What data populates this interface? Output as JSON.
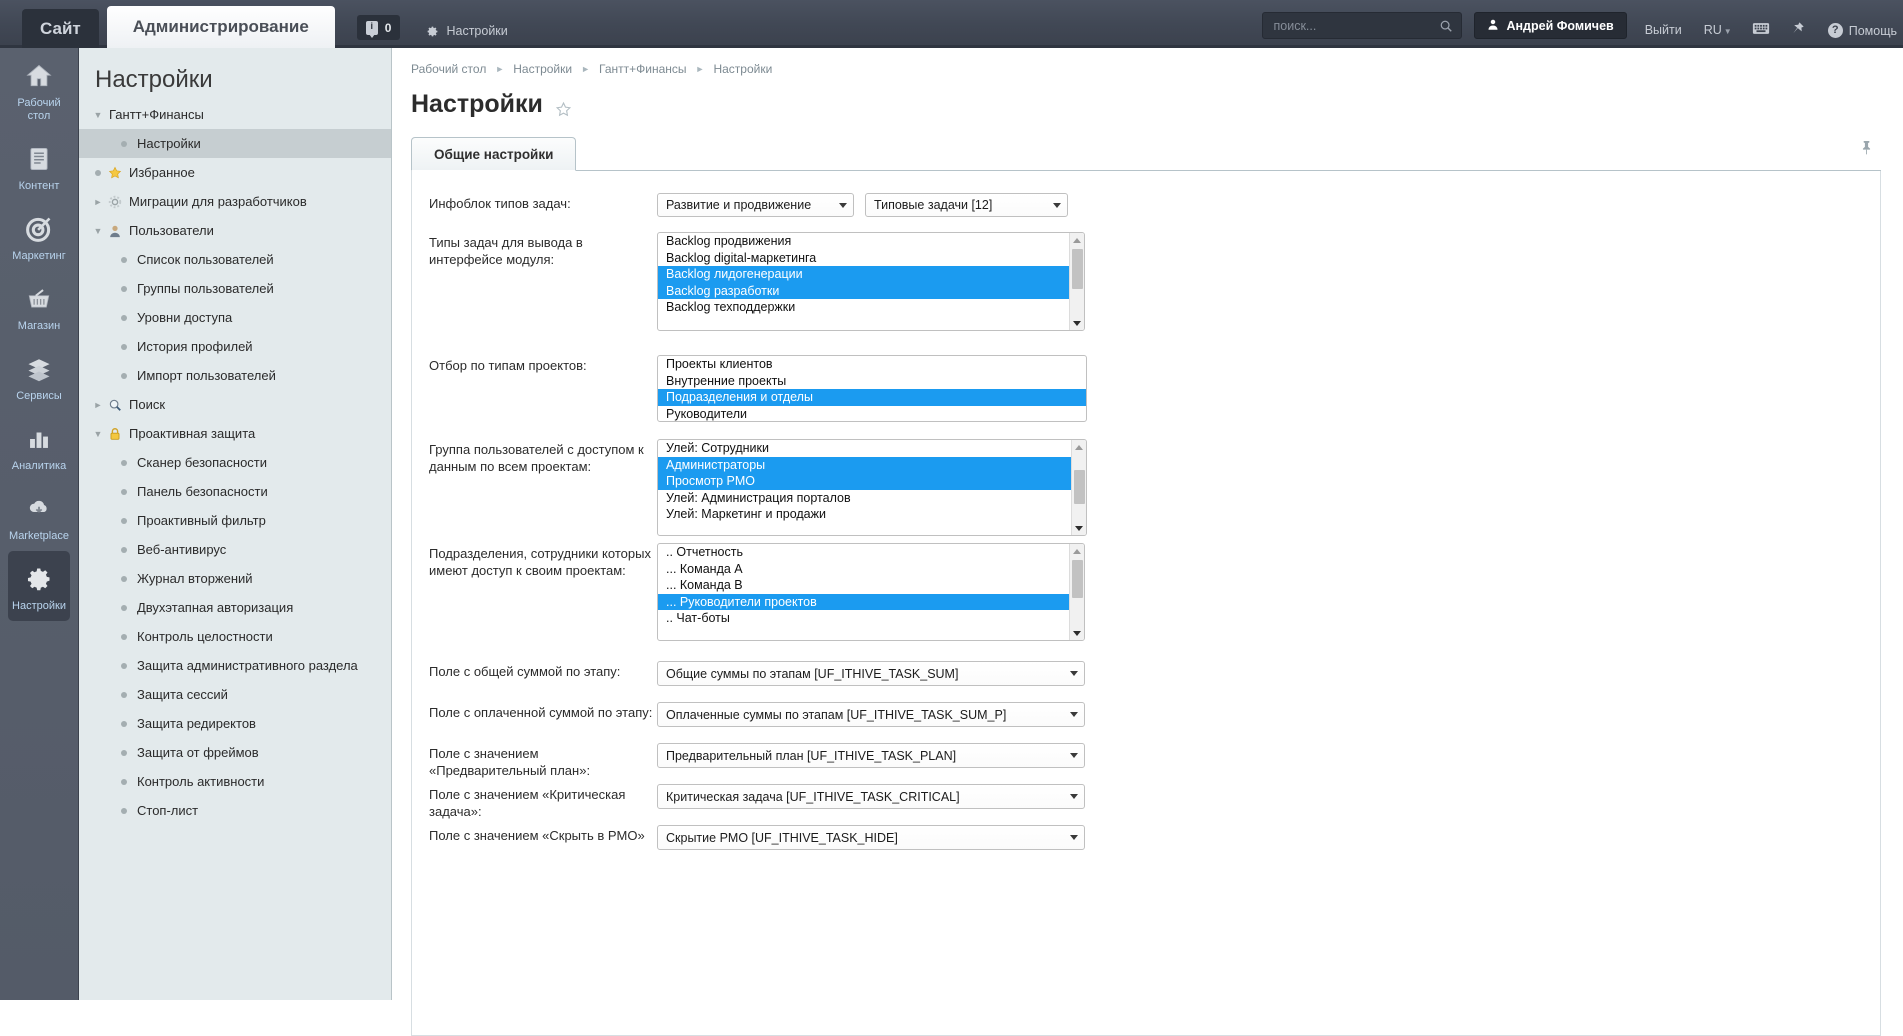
{
  "topbar": {
    "site_tab": "Сайт",
    "admin_tab": "Администрирование",
    "counter_value": "0",
    "counter_icon": "info-icon",
    "settings_link": "Настройки",
    "search_placeholder": "поиск...",
    "search_value": "",
    "user_name": "Андрей Фомичев",
    "logout": "Выйти",
    "language": "RU",
    "help": "Помощь"
  },
  "rail": {
    "items": [
      {
        "label": "Рабочий стол",
        "icon": "home-icon",
        "selected": false
      },
      {
        "label": "Контент",
        "icon": "document-icon",
        "selected": false
      },
      {
        "label": "Маркетинг",
        "icon": "target-icon",
        "selected": false
      },
      {
        "label": "Магазин",
        "icon": "basket-icon",
        "selected": false
      },
      {
        "label": "Сервисы",
        "icon": "layers-icon",
        "selected": false
      },
      {
        "label": "Аналитика",
        "icon": "bar-chart-icon",
        "selected": false
      },
      {
        "label": "Marketplace",
        "icon": "cloud-download-icon",
        "selected": false
      },
      {
        "label": "Настройки",
        "icon": "gear-icon",
        "selected": true
      }
    ]
  },
  "sidebar": {
    "title": "Настройки",
    "items": [
      {
        "label": "Гантт+Финансы",
        "type": "group",
        "twisty": "down",
        "icon": "",
        "selected": false
      },
      {
        "label": "Настройки",
        "type": "leaf2",
        "twisty": "",
        "icon": "",
        "selected": true
      },
      {
        "label": "Избранное",
        "type": "icon",
        "twisty": "bullet",
        "icon": "star-icon",
        "selected": false
      },
      {
        "label": "Миграции для разработчиков",
        "type": "icon",
        "twisty": "right",
        "icon": "gear-icon",
        "selected": false
      },
      {
        "label": "Пользователи",
        "type": "icon",
        "twisty": "down",
        "icon": "user-icon",
        "selected": false
      },
      {
        "label": "Список пользователей",
        "type": "leaf2",
        "twisty": "",
        "icon": "",
        "selected": false
      },
      {
        "label": "Группы пользователей",
        "type": "leaf2",
        "twisty": "",
        "icon": "",
        "selected": false
      },
      {
        "label": "Уровни доступа",
        "type": "leaf2",
        "twisty": "",
        "icon": "",
        "selected": false
      },
      {
        "label": "История профилей",
        "type": "leaf2",
        "twisty": "",
        "icon": "",
        "selected": false
      },
      {
        "label": "Импорт пользователей",
        "type": "leaf2",
        "twisty": "",
        "icon": "",
        "selected": false
      },
      {
        "label": "Поиск",
        "type": "icon",
        "twisty": "right",
        "icon": "search-icon",
        "selected": false
      },
      {
        "label": "Проактивная защита",
        "type": "icon",
        "twisty": "down",
        "icon": "lock-icon",
        "selected": false
      },
      {
        "label": "Сканер безопасности",
        "type": "leaf2",
        "twisty": "",
        "icon": "",
        "selected": false
      },
      {
        "label": "Панель безопасности",
        "type": "leaf2",
        "twisty": "",
        "icon": "",
        "selected": false
      },
      {
        "label": "Проактивный фильтр",
        "type": "leaf2",
        "twisty": "",
        "icon": "",
        "selected": false
      },
      {
        "label": "Веб-антивирус",
        "type": "leaf2",
        "twisty": "",
        "icon": "",
        "selected": false
      },
      {
        "label": "Журнал вторжений",
        "type": "leaf2",
        "twisty": "",
        "icon": "",
        "selected": false
      },
      {
        "label": "Двухэтапная авторизация",
        "type": "leaf2",
        "twisty": "",
        "icon": "",
        "selected": false
      },
      {
        "label": "Контроль целостности",
        "type": "leaf2",
        "twisty": "",
        "icon": "",
        "selected": false
      },
      {
        "label": "Защита административного раздела",
        "type": "leaf2",
        "twisty": "",
        "icon": "",
        "selected": false
      },
      {
        "label": "Защита сессий",
        "type": "leaf2",
        "twisty": "",
        "icon": "",
        "selected": false
      },
      {
        "label": "Защита редиректов",
        "type": "leaf2",
        "twisty": "",
        "icon": "",
        "selected": false
      },
      {
        "label": "Защита от фреймов",
        "type": "leaf2",
        "twisty": "",
        "icon": "",
        "selected": false
      },
      {
        "label": "Контроль активности",
        "type": "leaf2",
        "twisty": "",
        "icon": "",
        "selected": false
      },
      {
        "label": "Стоп-лист",
        "type": "leaf2",
        "twisty": "",
        "icon": "",
        "selected": false
      }
    ]
  },
  "breadcrumb": [
    "Рабочий стол",
    "Настройки",
    "Гантт+Финансы",
    "Настройки"
  ],
  "page": {
    "title": "Настройки",
    "favorite_icon": "star-outline-icon",
    "pin_icon": "pin-icon"
  },
  "tabs": [
    {
      "label": "Общие настройки",
      "active": true
    }
  ],
  "form": {
    "infoblock": {
      "label": "Инфоблок типов задач:",
      "select_a": "Развитие и продвижение",
      "select_b": "Типовые задачи [12]"
    },
    "task_types": {
      "label": "Типы задач для вывода в интерфейсе модуля:",
      "options": [
        {
          "text": "Backlog продвижения",
          "selected": false
        },
        {
          "text": "Backlog digital-маркетинга",
          "selected": false
        },
        {
          "text": "Backlog лидогенерации",
          "selected": true
        },
        {
          "text": "Backlog разработки",
          "selected": true
        },
        {
          "text": "Backlog техподдержки",
          "selected": false
        }
      ]
    },
    "project_types": {
      "label": "Отбор по типам проектов:",
      "options": [
        {
          "text": "Проекты клиентов",
          "selected": false
        },
        {
          "text": "Внутренние проекты",
          "selected": false
        },
        {
          "text": "Подразделения и отделы",
          "selected": true
        },
        {
          "text": "Руководители",
          "selected": false
        }
      ]
    },
    "access_group": {
      "label": "Группа пользователей с доступом к данным по всем проектам:",
      "options": [
        {
          "text": "Улей: Сотрудники",
          "selected": false
        },
        {
          "text": "Администраторы",
          "selected": true
        },
        {
          "text": "Просмотр PMO",
          "selected": true
        },
        {
          "text": "Улей: Администрация порталов",
          "selected": false
        },
        {
          "text": "Улей: Маркетинг и продажи",
          "selected": false
        }
      ]
    },
    "departments": {
      "label": "Подразделения, сотрудники которых имеют доступ к своим проектам:",
      "options": [
        {
          "text": ".. Отчетность",
          "selected": false
        },
        {
          "text": "... Команда A",
          "selected": false
        },
        {
          "text": "... Команда B",
          "selected": false
        },
        {
          "text": "... Руководители проектов",
          "selected": true
        },
        {
          "text": ".. Чат-боты",
          "selected": false
        }
      ]
    },
    "sum_field": {
      "label": "Поле с общей суммой по этапу:",
      "value": "Общие суммы по этапам [UF_ITHIVE_TASK_SUM]"
    },
    "paid_field": {
      "label": "Поле с оплаченной суммой по этапу:",
      "value": "Оплаченные суммы по этапам [UF_ITHIVE_TASK_SUM_P]"
    },
    "plan_field": {
      "label": "Поле с значением «Предварительный план»:",
      "value": "Предварительный план [UF_ITHIVE_TASK_PLAN]"
    },
    "critical_field": {
      "label": "Поле с значением «Критическая задача»:",
      "value": "Критическая задача [UF_ITHIVE_TASK_CRITICAL]"
    },
    "hide_field": {
      "label": "Поле с значением «Скрыть в PMO»",
      "value": "Скрытие PMO [UF_ITHIVE_TASK_HIDE]"
    }
  },
  "colors": {
    "accent_selection": "#1b9bf0",
    "topbar_bg": "#414855",
    "rail_bg": "#545b68",
    "sidebar_bg": "#e3eaec",
    "sidebar_selected": "#c6ced1"
  }
}
